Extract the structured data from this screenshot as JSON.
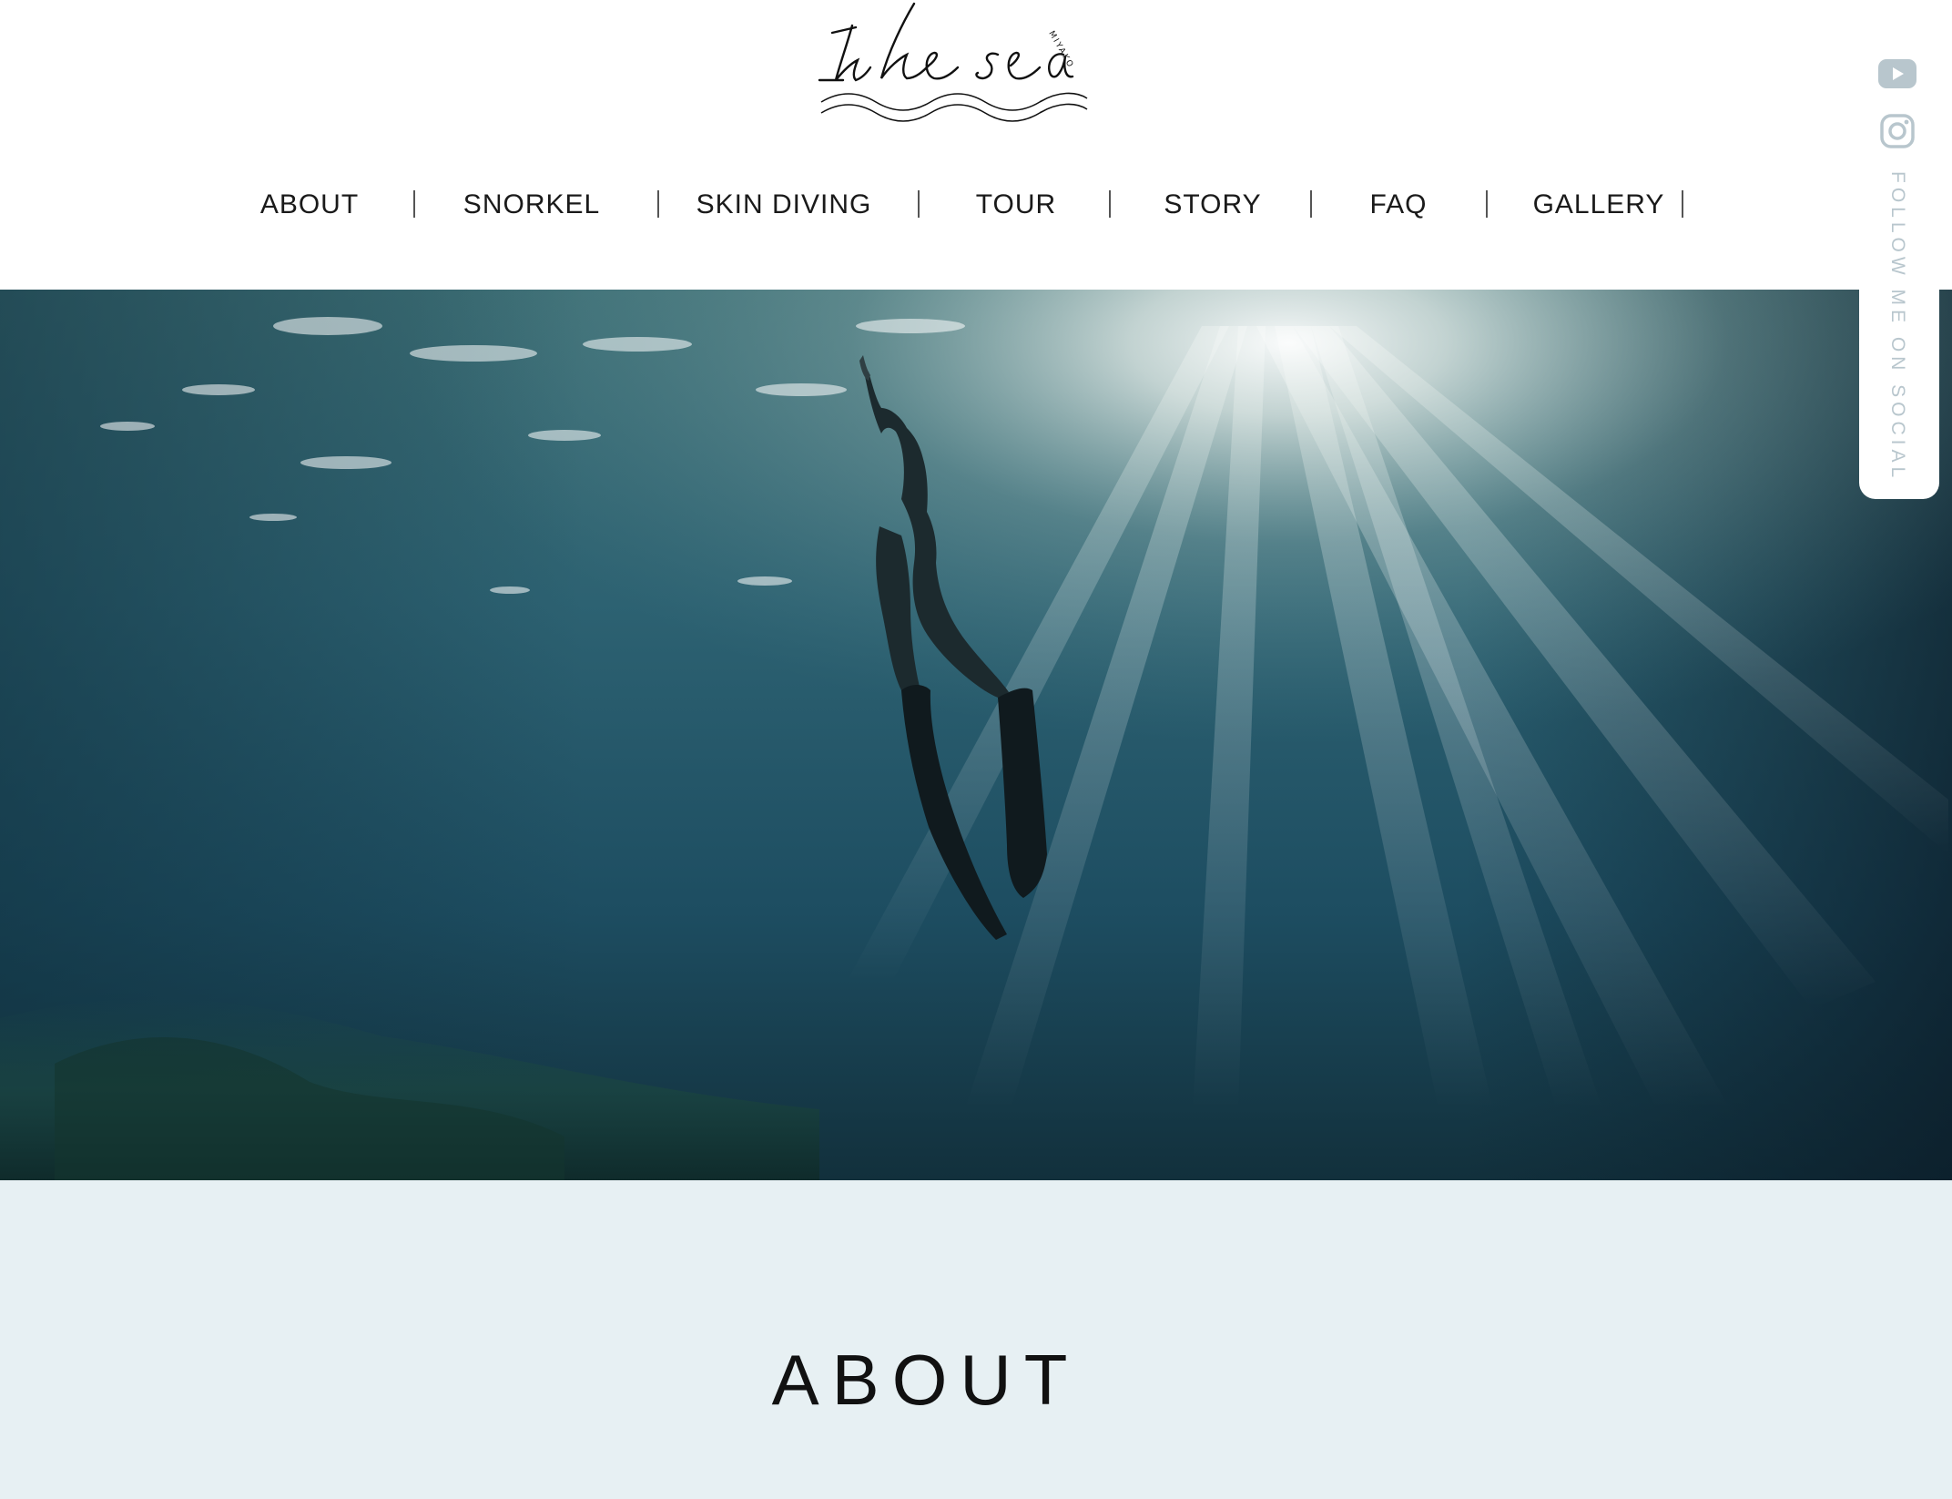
{
  "brand": {
    "logo_text": "the sea",
    "logo_subtext": "MIYAKO"
  },
  "nav": {
    "items": [
      {
        "label": "ABOUT"
      },
      {
        "label": "SNORKEL"
      },
      {
        "label": "SKIN DIVING"
      },
      {
        "label": "TOUR"
      },
      {
        "label": "STORY"
      },
      {
        "label": "FAQ"
      },
      {
        "label": "GALLERY"
      }
    ]
  },
  "social": {
    "follow_label": "FOLLOW ME ON SOCIAL",
    "icons": [
      "youtube-icon",
      "instagram-icon"
    ],
    "icon_color": "#b8c6cd"
  },
  "hero": {
    "image": "underwater-freediver-photo"
  },
  "about": {
    "title": "ABOUT",
    "background": "#e7f0f3"
  }
}
